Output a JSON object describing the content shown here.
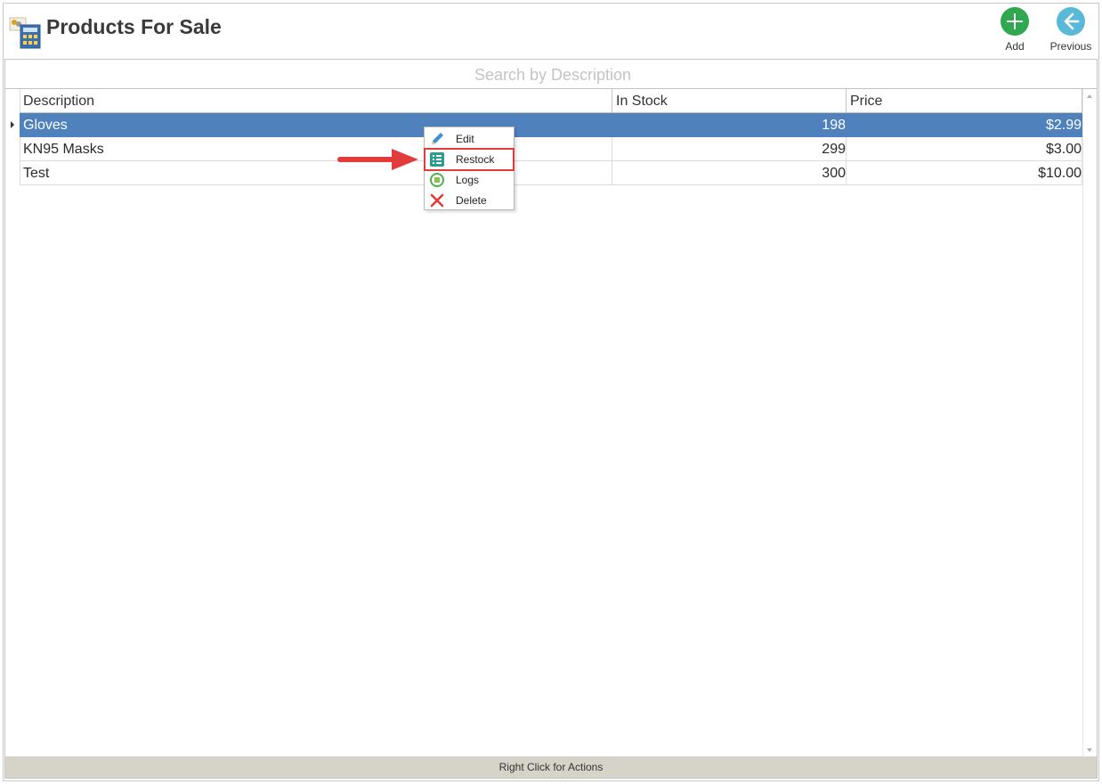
{
  "header": {
    "title": "Products For Sale",
    "add_label": "Add",
    "previous_label": "Previous"
  },
  "search": {
    "placeholder": "Search by Description"
  },
  "table": {
    "columns": [
      "Description",
      "In Stock",
      "Price"
    ],
    "rows": [
      {
        "description": "Gloves",
        "in_stock": "198",
        "price": "$2.99",
        "selected": true
      },
      {
        "description": "KN95 Masks",
        "in_stock": "299",
        "price": "$3.00",
        "selected": false
      },
      {
        "description": "Test",
        "in_stock": "300",
        "price": "$10.00",
        "selected": false
      }
    ]
  },
  "context_menu": {
    "items": [
      {
        "label": "Edit",
        "icon": "pencil-icon"
      },
      {
        "label": "Restock",
        "icon": "checklist-icon",
        "highlighted": true
      },
      {
        "label": "Logs",
        "icon": "logs-icon"
      },
      {
        "label": "Delete",
        "icon": "delete-x-icon"
      }
    ]
  },
  "status_bar": {
    "text": "Right Click for Actions"
  },
  "colors": {
    "selection": "#4f81bd",
    "add_button": "#2fa84f",
    "previous_button": "#5ab9d8",
    "annotation": "#e23b3b",
    "status_bar": "#d6d3c9"
  }
}
